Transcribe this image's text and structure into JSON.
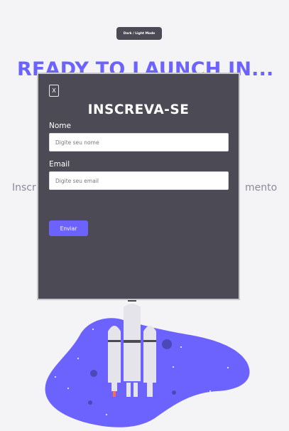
{
  "theme_toggle": {
    "label": "Dark / Light Mode"
  },
  "headline": "READY TO LAUNCH IN...",
  "background_text": {
    "left": "Inscr",
    "right": "mento"
  },
  "modal": {
    "close_label": "X",
    "title": "INSCREVA-SE",
    "name_label": "Nome",
    "name_placeholder": "Digite seu nome",
    "email_label": "Email",
    "email_placeholder": "Digite seu email",
    "submit_label": "Enviar"
  },
  "colors": {
    "accent": "#6c63ff",
    "modal_bg": "#4b4a55",
    "page_bg": "#f4f4f6"
  }
}
